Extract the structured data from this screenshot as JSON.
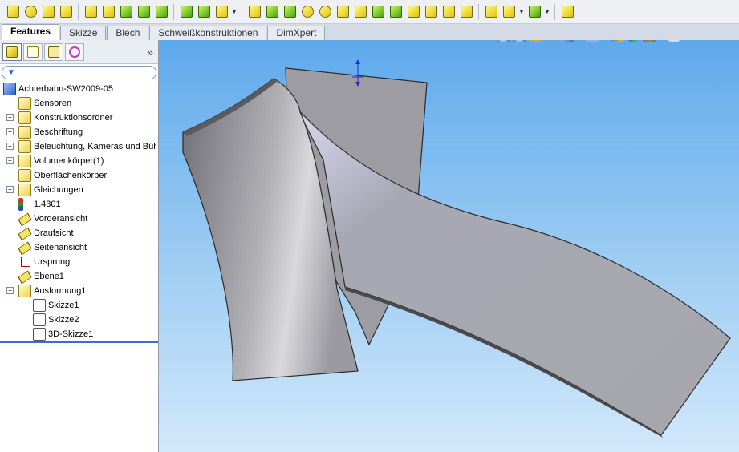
{
  "toolbar": {
    "buttons": [
      "extrude-icon",
      "revolve-icon",
      "sweep-icon",
      "loft-icon",
      "boundary-icon",
      "cut-icon",
      "fillet-icon",
      "chamfer-icon",
      "rib-icon",
      "draft-icon",
      "shell-icon",
      "wrap-icon",
      "pattern-icon",
      "dome-icon",
      "flex-icon",
      "freeform-icon",
      "deform-icon",
      "indent-icon",
      "intersect-icon",
      "combine-icon",
      "split-icon",
      "move-body-icon",
      "delete-body-icon",
      "section-view-icon",
      "reference-geometry-icon",
      "curves-icon",
      "instant3d-icon"
    ]
  },
  "tabs": [
    {
      "label": "Features",
      "active": true
    },
    {
      "label": "Skizze",
      "active": false
    },
    {
      "label": "Blech",
      "active": false
    },
    {
      "label": "Schweißkonstruktionen",
      "active": false
    },
    {
      "label": "DimXpert",
      "active": false
    }
  ],
  "fm": {
    "expand_symbol": "»",
    "tree": [
      {
        "label": "Achterbahn-SW2009-05",
        "icon": "part-icon"
      },
      {
        "label": "Sensoren",
        "icon": "sensor-icon"
      },
      {
        "label": "Konstruktionsordner",
        "icon": "design-binder-icon"
      },
      {
        "label": "Beschriftung",
        "icon": "annotations-icon"
      },
      {
        "label": "Beleuchtung, Kameras und Bühne",
        "icon": "lights-icon"
      },
      {
        "label": "Volumenkörper(1)",
        "icon": "solid-bodies-icon"
      },
      {
        "label": "Oberflächenkörper",
        "icon": "surface-bodies-icon"
      },
      {
        "label": "Gleichungen",
        "icon": "equations-icon"
      },
      {
        "label": "1.4301",
        "icon": "material-icon"
      },
      {
        "label": "Vorderansicht",
        "icon": "plane-icon"
      },
      {
        "label": "Draufsicht",
        "icon": "plane-icon"
      },
      {
        "label": "Seitenansicht",
        "icon": "plane-icon"
      },
      {
        "label": "Ursprung",
        "icon": "origin-icon"
      },
      {
        "label": "Ebene1",
        "icon": "plane-icon"
      },
      {
        "label": "Ausformung1",
        "icon": "loft-icon"
      },
      {
        "label": "Skizze1",
        "icon": "sketch-icon"
      },
      {
        "label": "Skizze2",
        "icon": "sketch-icon"
      },
      {
        "label": "3D-Skizze1",
        "icon": "3d-sketch-icon"
      }
    ]
  },
  "colors": {
    "viewport_top": "#5ea9ec",
    "viewport_bottom": "#d2e8fb",
    "body_face": "#a8a8ad",
    "selection_blue": "#3a6ec8"
  }
}
